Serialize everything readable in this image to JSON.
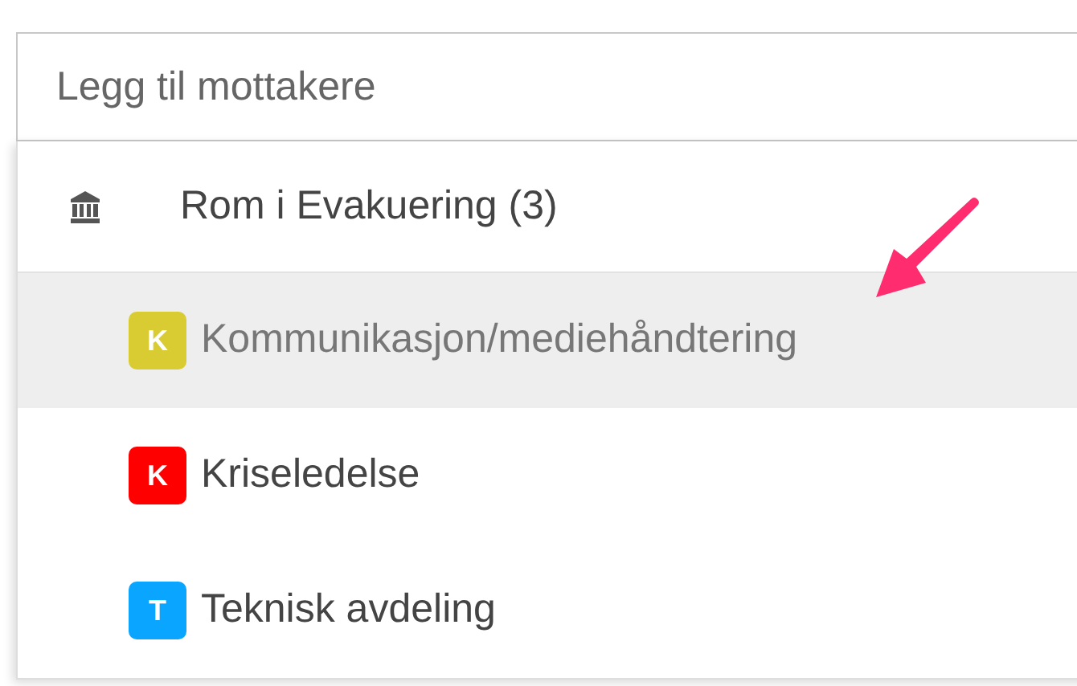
{
  "search": {
    "placeholder": "Legg til mottakere"
  },
  "group": {
    "label": "Rom i Evakuering (3)"
  },
  "items": [
    {
      "initial": "K",
      "label": "Kommunikasjon/mediehåndtering",
      "color": "#d9cc33",
      "selected": true
    },
    {
      "initial": "K",
      "label": "Kriseledelse",
      "color": "#ff0000",
      "selected": false
    },
    {
      "initial": "T",
      "label": "Teknisk avdeling",
      "color": "#0aa5ff",
      "selected": false
    }
  ]
}
